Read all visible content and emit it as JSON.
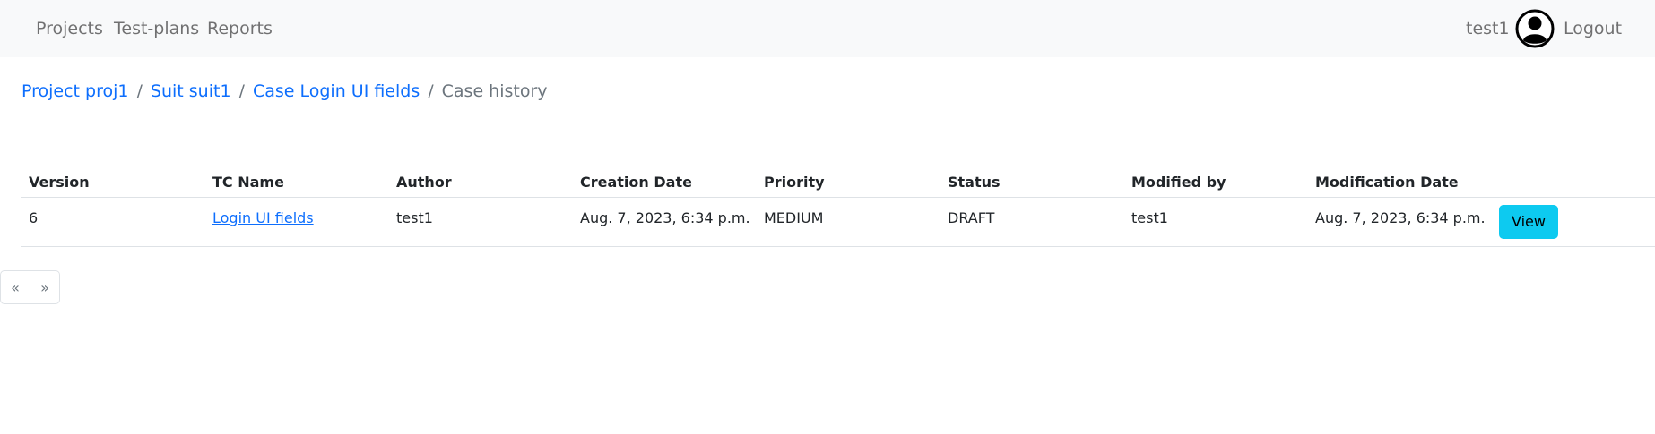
{
  "navbar": {
    "links": {
      "projects": "Projects",
      "testplans": "Test-plans",
      "reports": "Reports"
    },
    "username": "test1",
    "logout": "Logout",
    "avatar_icon": "user-circle-icon"
  },
  "breadcrumb": {
    "project": "Project proj1",
    "suit": "Suit suit1",
    "case": "Case Login UI fields",
    "current": "Case history",
    "separator": "/"
  },
  "table": {
    "headers": [
      "Version",
      "TC Name",
      "Author",
      "Creation Date",
      "Priority",
      "Status",
      "Modified by",
      "Modification Date",
      ""
    ],
    "rows": [
      {
        "version": "6",
        "tc_name": "Login UI fields",
        "author": "test1",
        "creation_date": "Aug. 7, 2023, 6:34 p.m.",
        "priority": "MEDIUM",
        "status": "DRAFT",
        "modified_by": "test1",
        "modification_date": "Aug. 7, 2023, 6:34 p.m.",
        "action": "View"
      }
    ]
  },
  "pagination": {
    "prev": "«",
    "next": "»"
  },
  "colors": {
    "navbar_bg": "#f8f9fa",
    "link": "#0d6efd",
    "view_button": "#0dcaf0"
  }
}
